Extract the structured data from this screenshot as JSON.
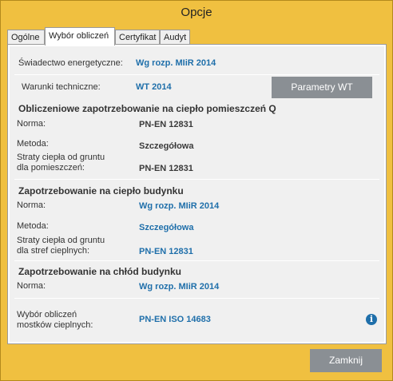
{
  "window": {
    "title": "Opcje"
  },
  "tabs": [
    "Ogólne",
    "Wybór obliczeń",
    "Certyfikat",
    "Audyt"
  ],
  "top": {
    "cert_label": "Świadectwo energetyczne:",
    "cert_value": "Wg rozp. MIiR 2014",
    "wt_label": "Warunki techniczne:",
    "wt_value": "WT 2014",
    "wt_button": "Parametry WT"
  },
  "sections": {
    "q": {
      "title": "Obliczeniowe zapotrzebowanie na ciepło pomieszczeń Q",
      "norma_label": "Norma:",
      "norma_value": "PN-EN 12831",
      "metoda_label": "Metoda:",
      "metoda_value": "Szczegółowa",
      "straty_label_1": "Straty ciepła od gruntu",
      "straty_label_2": "dla pomieszczeń:",
      "straty_value": "PN-EN 12831"
    },
    "heat": {
      "title": "Zapotrzebowanie na ciepło budynku",
      "norma_label": "Norma:",
      "norma_value": "Wg rozp. MIiR 2014",
      "metoda_label": "Metoda:",
      "metoda_value": "Szczegółowa",
      "straty_label_1": "Straty ciepła od gruntu",
      "straty_label_2": "dla stref cieplnych:",
      "straty_value": "PN-EN 12831"
    },
    "cool": {
      "title": "Zapotrzebowanie na chłód budynku",
      "norma_label": "Norma:",
      "norma_value": "Wg rozp. MIiR 2014"
    },
    "bridges": {
      "label_1": "Wybór obliczeń",
      "label_2": "mostków cieplnych:",
      "value": "PN-EN ISO 14683",
      "info_icon": "i"
    }
  },
  "footer": {
    "close_button": "Zamknij"
  }
}
